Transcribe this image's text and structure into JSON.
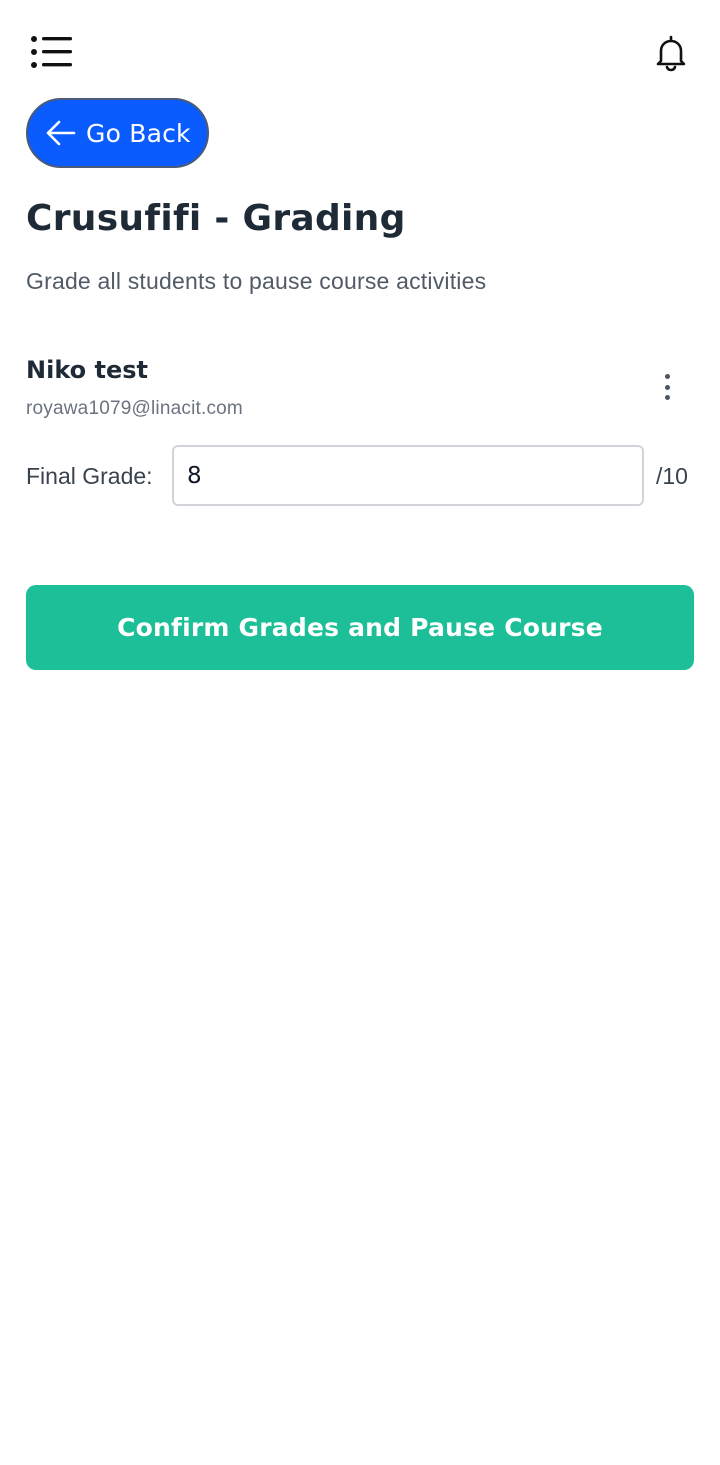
{
  "header": {
    "menu_icon": "list-menu-icon",
    "notifications_icon": "bell-icon"
  },
  "back_button": {
    "label": "Go Back",
    "icon": "arrow-left-icon",
    "color": "#0a5cff"
  },
  "page": {
    "title": "Crusufifi - Grading",
    "subtitle": "Grade all students to pause course activities"
  },
  "students": [
    {
      "name": "Niko test",
      "email": "royawa1079@linacit.com",
      "grade_label": "Final Grade:",
      "grade_value": "8",
      "grade_max": "/10",
      "more_icon": "more-vertical-icon"
    }
  ],
  "confirm_button": {
    "label": "Confirm Grades and Pause Course",
    "color": "#1dbf98"
  }
}
